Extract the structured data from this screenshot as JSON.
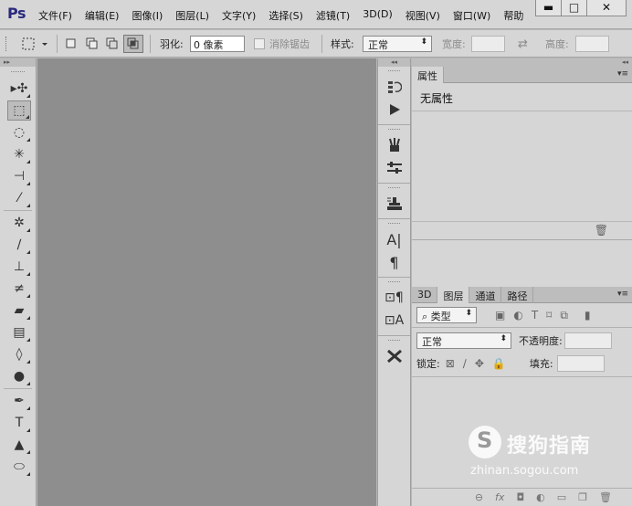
{
  "app": {
    "logo": "Ps"
  },
  "menu": [
    "文件(F)",
    "编辑(E)",
    "图像(I)",
    "图层(L)",
    "文字(Y)",
    "选择(S)",
    "滤镜(T)",
    "3D(D)",
    "视图(V)",
    "窗口(W)",
    "帮助"
  ],
  "window_controls": {
    "minimize": "▬",
    "maximize": "□",
    "close": "✕"
  },
  "options": {
    "feather_label": "羽化:",
    "feather_value": "0 像素",
    "antialias_label": "消除锯齿",
    "style_label": "样式:",
    "style_value": "正常",
    "width_label": "宽度:",
    "height_label": "高度:",
    "swap_icon": "⇄"
  },
  "tools": [
    {
      "icon": "move-icon",
      "glyph": "▸✣"
    },
    {
      "icon": "rect-marquee-icon",
      "glyph": "⬚"
    },
    {
      "icon": "lasso-icon",
      "glyph": "◌"
    },
    {
      "icon": "magic-wand-icon",
      "glyph": "✳"
    },
    {
      "icon": "crop-icon",
      "glyph": "⊣"
    },
    {
      "icon": "eyedropper-icon",
      "glyph": "⁄"
    },
    {
      "icon": "healing-brush-icon",
      "glyph": "✲"
    },
    {
      "icon": "brush-icon",
      "glyph": "∕"
    },
    {
      "icon": "clone-stamp-icon",
      "glyph": "⊥"
    },
    {
      "icon": "history-brush-icon",
      "glyph": "≠"
    },
    {
      "icon": "eraser-icon",
      "glyph": "▰"
    },
    {
      "icon": "gradient-icon",
      "glyph": "▤"
    },
    {
      "icon": "blur-icon",
      "glyph": "◊"
    },
    {
      "icon": "dodge-icon",
      "glyph": "●"
    },
    {
      "icon": "pen-icon",
      "glyph": "✒"
    },
    {
      "icon": "type-icon",
      "glyph": "T"
    },
    {
      "icon": "path-select-icon",
      "glyph": "▲"
    },
    {
      "icon": "ellipse-icon",
      "glyph": "⬭"
    }
  ],
  "dock": [
    "history-icon",
    "actions-icon",
    "brush-presets-icon",
    "adjust-icon",
    "clone-source-icon",
    "character-icon",
    "paragraph-icon",
    "char-styles-icon",
    "para-styles-icon",
    "tool-presets-icon"
  ],
  "properties": {
    "tab": "属性",
    "message": "无属性"
  },
  "layers": {
    "tabs": [
      "3D",
      "图层",
      "通道",
      "路径"
    ],
    "filter_label": "类型",
    "blend_mode": "正常",
    "opacity_label": "不透明度:",
    "lock_label": "锁定:",
    "fill_label": "填充:"
  },
  "watermark": {
    "text": "搜狗指南",
    "url": "zhinan.sogou.com",
    "logo": "S"
  }
}
